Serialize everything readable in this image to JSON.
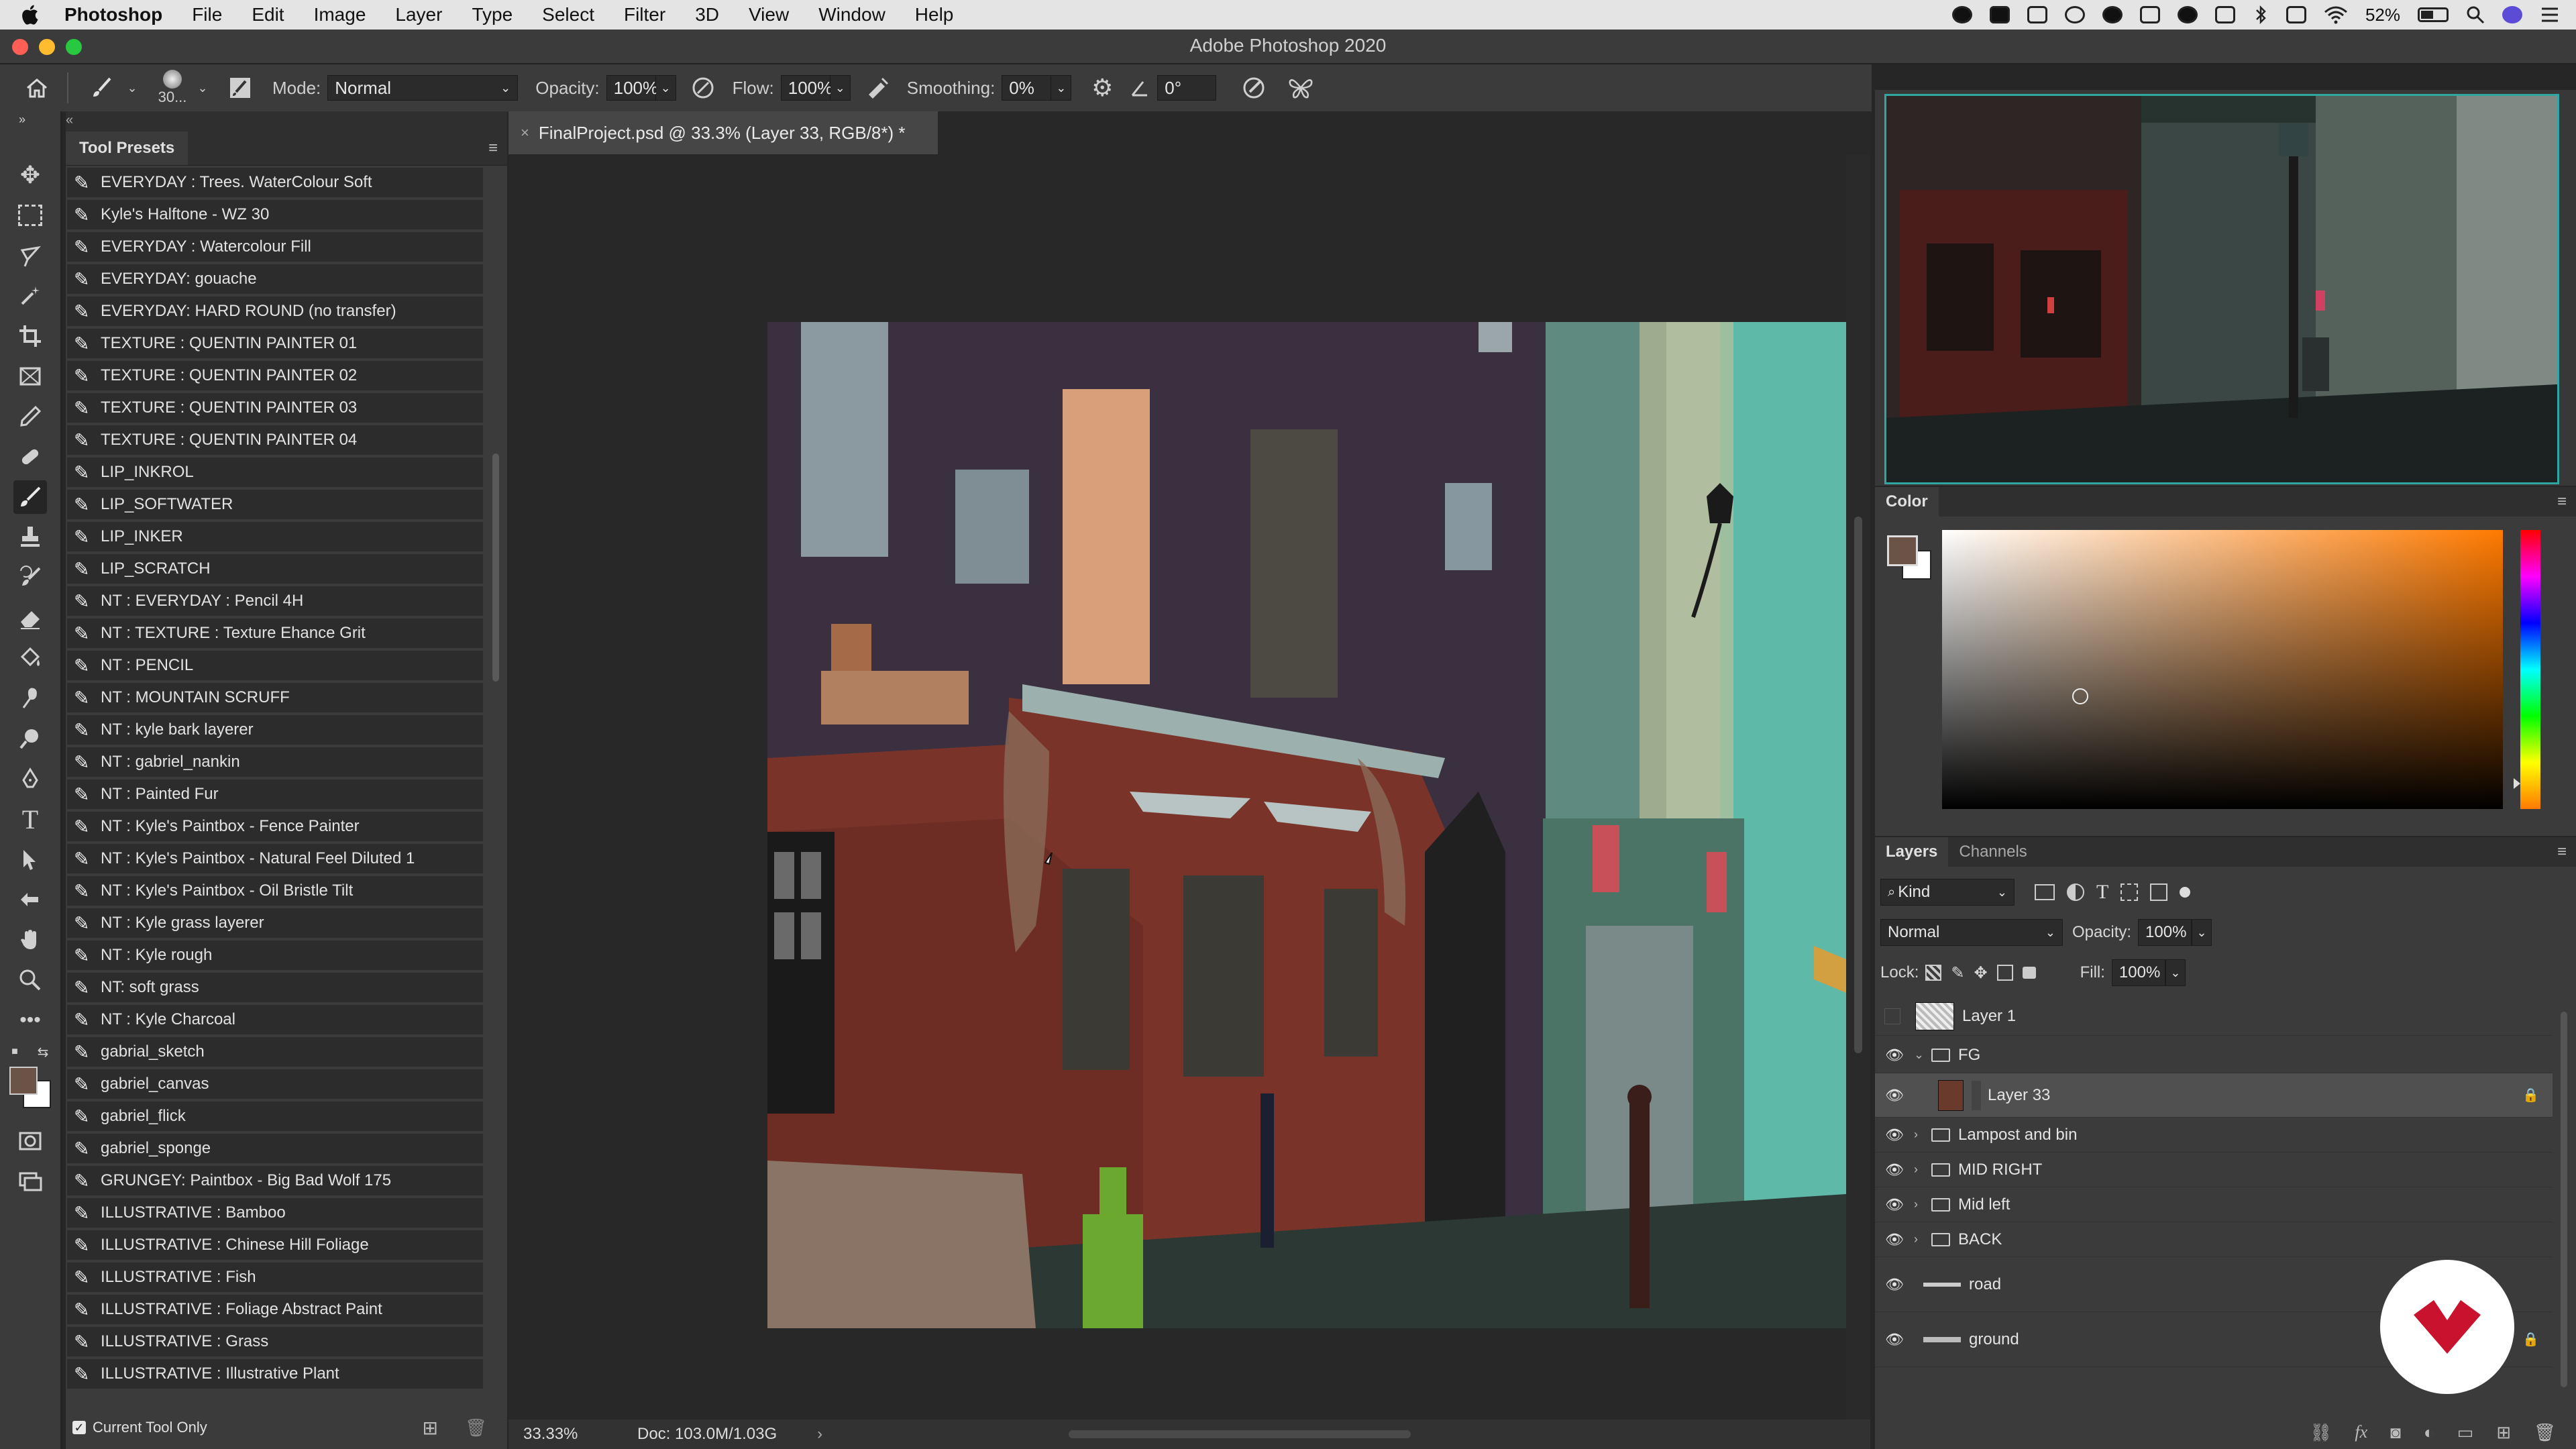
{
  "menubar": {
    "app_name": "Photoshop",
    "items": [
      "File",
      "Edit",
      "Image",
      "Layer",
      "Type",
      "Select",
      "Filter",
      "3D",
      "View",
      "Window",
      "Help"
    ],
    "battery": "52%"
  },
  "window": {
    "title": "Adobe Photoshop 2020"
  },
  "options": {
    "brush_size": "30...",
    "mode_label": "Mode:",
    "mode_value": "Normal",
    "opacity_label": "Opacity:",
    "opacity_value": "100%",
    "flow_label": "Flow:",
    "flow_value": "100%",
    "smoothing_label": "Smoothing:",
    "smoothing_value": "0%",
    "angle_value": "0°"
  },
  "document": {
    "tab_title": "FinalProject.psd @ 33.3% (Layer 33, RGB/8*) *",
    "zoom": "33.33%",
    "doc_info": "Doc: 103.0M/1.03G"
  },
  "tool_presets": {
    "title": "Tool Presets",
    "items": [
      "EVERYDAY : Trees. WaterColour Soft",
      "Kyle's Halftone - WZ 30",
      "EVERYDAY : Watercolour Fill",
      "EVERYDAY: gouache",
      "EVERYDAY: HARD ROUND (no transfer)",
      "TEXTURE : QUENTIN PAINTER 01",
      "TEXTURE : QUENTIN PAINTER 02",
      "TEXTURE : QUENTIN PAINTER 03",
      "TEXTURE : QUENTIN PAINTER 04",
      "LIP_INKROL",
      "LIP_SOFTWATER",
      "LIP_INKER",
      "LIP_SCRATCH",
      "NT : EVERYDAY : Pencil 4H",
      "NT : TEXTURE : Texture Ehance Grit",
      "NT : PENCIL",
      "NT : MOUNTAIN SCRUFF",
      "NT : kyle bark layerer",
      "NT : gabriel_nankin",
      "NT : Painted Fur",
      "NT : Kyle's Paintbox - Fence Painter",
      "NT : Kyle's Paintbox - Natural Feel Diluted 1",
      "NT : Kyle's Paintbox - Oil Bristle Tilt",
      "NT : Kyle grass layerer",
      "NT : Kyle rough",
      "NT: soft grass",
      "NT : Kyle Charcoal",
      "gabrial_sketch",
      "gabriel_canvas",
      "gabriel_flick",
      "gabriel_sponge",
      "GRUNGEY: Paintbox - Big Bad Wolf 175",
      "ILLUSTRATIVE : Bamboo",
      "ILLUSTRATIVE : Chinese Hill Foliage",
      "ILLUSTRATIVE : Fish",
      "ILLUSTRATIVE : Foliage Abstract Paint",
      "ILLUSTRATIVE : Grass",
      "ILLUSTRATIVE : Illustrative Plant"
    ],
    "current_tool_only": "Current Tool Only"
  },
  "color_panel": {
    "title": "Color",
    "fg_color": "#6b5347",
    "bg_color": "#ffffff",
    "hue_color": "#ff7a00"
  },
  "layers_panel": {
    "tabs": [
      "Layers",
      "Channels"
    ],
    "filter_kind": "Kind",
    "blend_mode": "Normal",
    "opacity_label": "Opacity:",
    "opacity_value": "100%",
    "lock_label": "Lock:",
    "fill_label": "Fill:",
    "fill_value": "100%",
    "layers": [
      {
        "name": "Layer 1",
        "type": "layer",
        "visible": false
      },
      {
        "name": "FG",
        "type": "group-open",
        "visible": true
      },
      {
        "name": "Layer 33",
        "type": "layer",
        "visible": true,
        "selected": true
      },
      {
        "name": "Lampost and bin",
        "type": "group",
        "visible": true
      },
      {
        "name": "MID RIGHT",
        "type": "group",
        "visible": true
      },
      {
        "name": "Mid left",
        "type": "group",
        "visible": true
      },
      {
        "name": "BACK",
        "type": "group",
        "visible": true
      },
      {
        "name": "road",
        "type": "layer",
        "visible": true
      },
      {
        "name": "ground",
        "type": "layer",
        "visible": true
      }
    ]
  }
}
